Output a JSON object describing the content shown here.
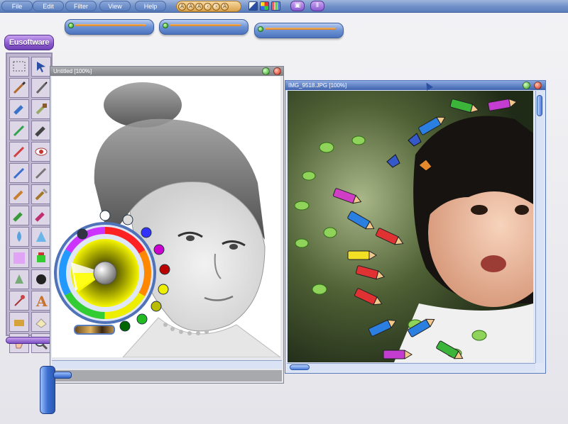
{
  "menu": {
    "items": [
      "File",
      "Edit",
      "Filter",
      "View",
      "Help"
    ]
  },
  "toolbar": {
    "nav_glyphs": [
      "A",
      "A",
      "A",
      "‹",
      "›",
      "A"
    ],
    "view_glyph": "▣",
    "pause_glyph": "Ⅱ"
  },
  "toolbox": {
    "brand": "Eusoftware",
    "tools": [
      {
        "name": "marquee-select-icon"
      },
      {
        "name": "move-arrow-icon"
      },
      {
        "name": "brush-icon"
      },
      {
        "name": "pen-icon"
      },
      {
        "name": "marker-icon"
      },
      {
        "name": "roller-icon"
      },
      {
        "name": "pencil-icon"
      },
      {
        "name": "wide-brush-icon"
      },
      {
        "name": "crayon-icon"
      },
      {
        "name": "eye-icon"
      },
      {
        "name": "airbrush-icon"
      },
      {
        "name": "line-icon"
      },
      {
        "name": "paint-brush-icon"
      },
      {
        "name": "fan-brush-icon"
      },
      {
        "name": "stamp-icon"
      },
      {
        "name": "sponge-icon"
      },
      {
        "name": "drop-icon"
      },
      {
        "name": "cone-icon"
      },
      {
        "name": "gradient-icon"
      },
      {
        "name": "bucket-icon"
      },
      {
        "name": "spray-icon"
      },
      {
        "name": "dark-circle-icon"
      },
      {
        "name": "eyedropper-icon"
      },
      {
        "name": "text-icon"
      },
      {
        "name": "fill-icon"
      },
      {
        "name": "eraser-icon"
      },
      {
        "name": "hand-icon"
      },
      {
        "name": "zoom-icon"
      }
    ]
  },
  "windows": {
    "sketch": {
      "title": "Untitled   [100%]"
    },
    "photo": {
      "title": "IMG_9518.JPG   [100%]"
    }
  },
  "colors": {
    "menubar": "#6f8fc8",
    "accent_purple": "#8a59cc",
    "accent_orange": "#d57d1f",
    "sketch_titlebar": "#8b8d91",
    "photo_titlebar": "#4f71b8"
  }
}
